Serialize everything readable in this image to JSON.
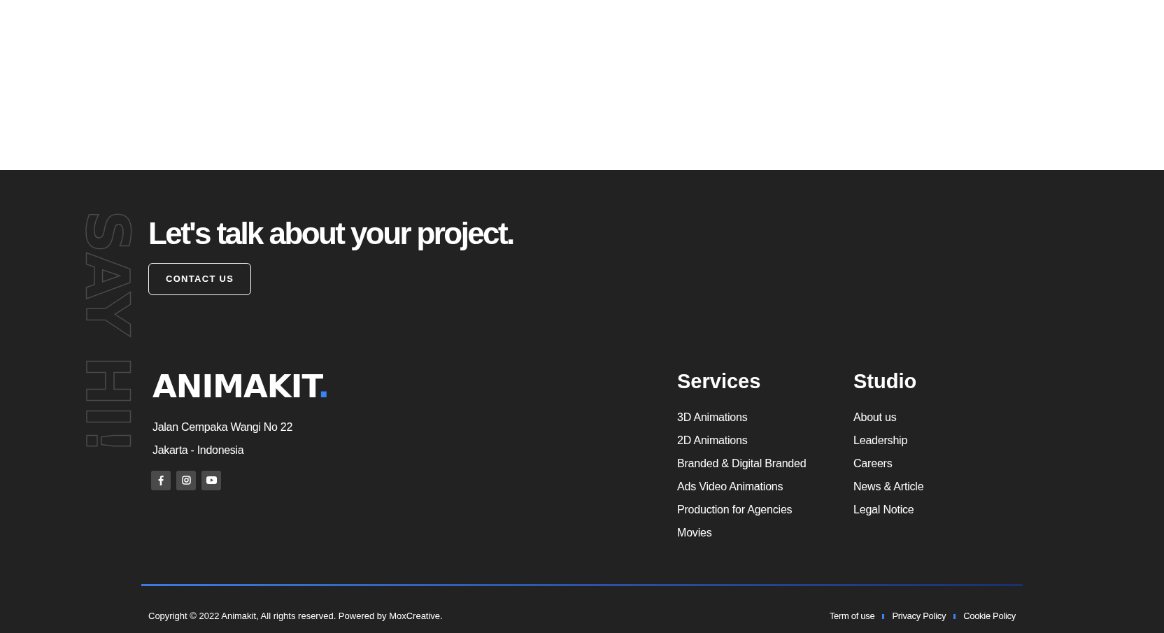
{
  "side_text": "SAY HI!",
  "headline": "Let's talk about your project.",
  "contact_button": "CONTACT US",
  "logo": {
    "text": "ANIMAKIT",
    "accent": "."
  },
  "address": [
    "Jalan Cempaka Wangi No 22",
    "Jakarta - Indonesia"
  ],
  "social": [
    {
      "kind": "facebook"
    },
    {
      "kind": "instagram"
    },
    {
      "kind": "youtube"
    }
  ],
  "menus": [
    {
      "title": "Services",
      "items": [
        "3D Animations",
        "2D Animations",
        "Branded & Digital Branded",
        "Ads Video Animations",
        "Production for Agencies",
        "Movies"
      ]
    },
    {
      "title": "Studio",
      "items": [
        "About us",
        "Leadership",
        "Careers",
        "News & Article",
        "Legal Notice"
      ]
    }
  ],
  "copyright": "Copyright © 2022 Animakit, All rights reserved. Powered by MoxCreative.",
  "legal_links": [
    "Term of use",
    "Privacy Policy",
    "Cookie Policy"
  ]
}
